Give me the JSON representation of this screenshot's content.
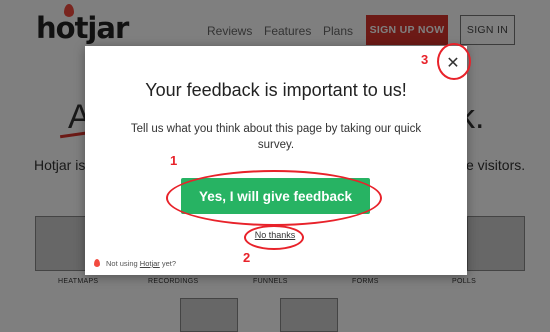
{
  "nav": {
    "logo": "hotjar",
    "links": [
      "Reviews",
      "Features",
      "Plans"
    ],
    "signup_label": "SIGN UP NOW",
    "signin_label": "SIGN IN"
  },
  "background": {
    "hero_left_fragment": "A",
    "hero_right_fragment": "k.",
    "intro_left_fragment": "Hotjar is",
    "intro_right_fragment": "e visitors.",
    "tools": [
      "HEATMAPS",
      "RECORDINGS",
      "FUNNELS",
      "FORMS",
      "POLLS"
    ]
  },
  "modal": {
    "title": "Your feedback is important to us!",
    "subtitle": "Tell us what you think about this page by taking our quick survey.",
    "cta_label": "Yes, I will give feedback",
    "decline_label": "No thanks",
    "close_symbol": "✕",
    "footer_prefix": "Not using",
    "footer_link": "Hotjar",
    "footer_suffix": "yet?"
  },
  "annotations": [
    "1",
    "2",
    "3"
  ],
  "colors": {
    "brand_red": "#d9342c",
    "cta_green": "#27b363",
    "annotation_red": "#e8222a"
  }
}
